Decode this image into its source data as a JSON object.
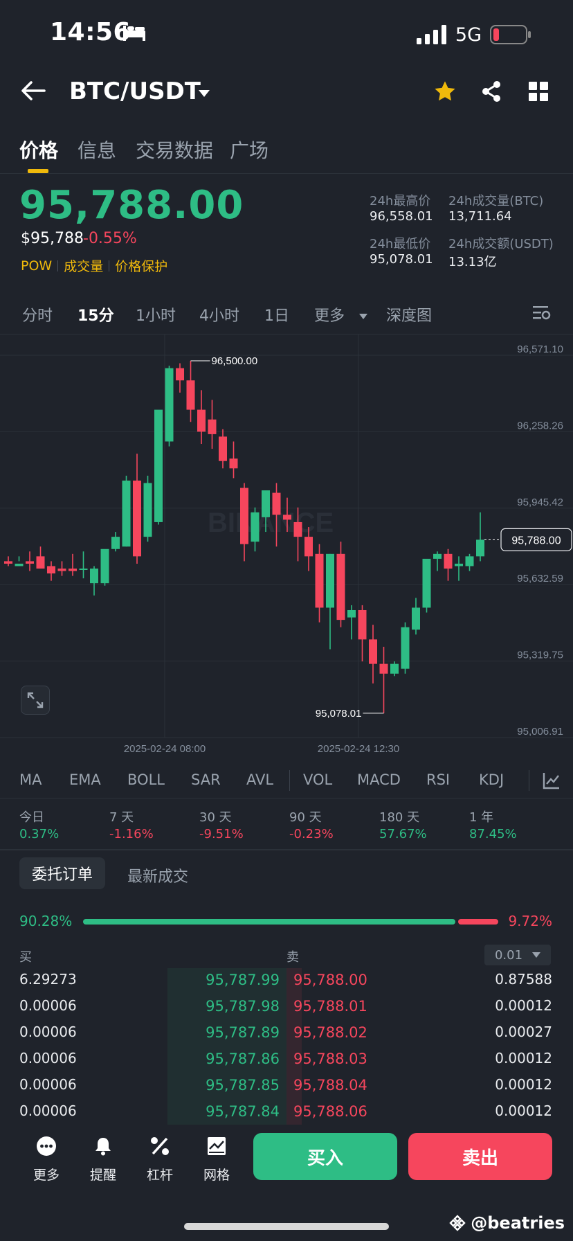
{
  "status_bar": {
    "time": "14:56",
    "network": "5G",
    "icons": [
      "bed-icon",
      "signal-icon",
      "battery-low-icon"
    ]
  },
  "header": {
    "pair": "BTC/USDT",
    "icons": [
      "back-arrow-icon",
      "caret-down-icon",
      "star-icon",
      "share-icon",
      "grid-icon"
    ]
  },
  "tabs": [
    {
      "label": "价格",
      "active": true
    },
    {
      "label": "信息"
    },
    {
      "label": "交易数据"
    },
    {
      "label": "广场"
    }
  ],
  "price": {
    "last": "95,788.00",
    "usd": "$95,788",
    "change_pct": "-0.55%",
    "tags": [
      "POW",
      "成交量",
      "价格保护"
    ]
  },
  "stats": {
    "high_label": "24h最高价",
    "high": "96,558.01",
    "vol_btc_label": "24h成交量(BTC)",
    "vol_btc": "13,711.64",
    "low_label": "24h最低价",
    "low": "95,078.01",
    "vol_usdt_label": "24h成交额(USDT)",
    "vol_usdt": "13.13亿"
  },
  "intervals": [
    {
      "label": "分时"
    },
    {
      "label": "15分",
      "active": true
    },
    {
      "label": "1小时"
    },
    {
      "label": "4小时"
    },
    {
      "label": "1日"
    },
    {
      "label": "更多"
    },
    {
      "label": "深度图"
    }
  ],
  "chart_data": {
    "type": "candlestick",
    "watermark": "BINANCE",
    "y_ticks": [
      "96,571.10",
      "96,258.26",
      "95,945.42",
      "95,632.59",
      "95,319.75",
      "95,006.91"
    ],
    "ylim": [
      95006.91,
      96571.1
    ],
    "x_ticks": [
      "2025-02-24 08:00",
      "2025-02-24 12:30"
    ],
    "current_price": "95,788.00",
    "high_label": "96,500.00",
    "low_label": "95,078.01",
    "candles": [
      [
        95700,
        95720,
        95690,
        95680
      ],
      [
        95680,
        95720,
        95690,
        95700
      ],
      [
        95700,
        95740,
        95690,
        95660
      ],
      [
        95720,
        95760,
        95670,
        95700
      ],
      [
        95680,
        95700,
        95650,
        95620
      ],
      [
        95670,
        95700,
        95660,
        95640
      ],
      [
        95670,
        95730,
        95660,
        95640
      ],
      [
        95670,
        95740,
        95670,
        95630
      ],
      [
        95610,
        95680,
        95670,
        95560
      ],
      [
        95610,
        95740,
        95750,
        95600
      ],
      [
        95750,
        95820,
        95800,
        95740
      ],
      [
        95760,
        96050,
        96030,
        95760
      ],
      [
        96030,
        96140,
        95720,
        95690
      ],
      [
        95800,
        96050,
        96020,
        95780
      ],
      [
        95860,
        96300,
        96320,
        95850
      ],
      [
        96190,
        96500,
        96490,
        96170
      ],
      [
        96490,
        96510,
        96440,
        96390
      ],
      [
        96440,
        96520,
        96320,
        96270
      ],
      [
        96320,
        96400,
        96230,
        96180
      ],
      [
        96280,
        96360,
        96220,
        96160
      ],
      [
        96210,
        96240,
        96110,
        96080
      ],
      [
        96120,
        96190,
        96080,
        96040
      ],
      [
        96000,
        96020,
        95770,
        95700
      ],
      [
        95780,
        95920,
        95900,
        95740
      ],
      [
        95880,
        95980,
        95990,
        95820
      ],
      [
        95980,
        96020,
        95890,
        95760
      ],
      [
        95890,
        95960,
        95870,
        95820
      ],
      [
        95860,
        95920,
        95800,
        95700
      ],
      [
        95800,
        95840,
        95720,
        95660
      ],
      [
        95730,
        95770,
        95510,
        95450
      ],
      [
        95510,
        95730,
        95730,
        95340
      ],
      [
        95730,
        95780,
        95460,
        95430
      ],
      [
        95470,
        95520,
        95500,
        95380
      ],
      [
        95500,
        95520,
        95380,
        95290
      ],
      [
        95380,
        95440,
        95280,
        95200
      ],
      [
        95280,
        95350,
        95240,
        95078
      ],
      [
        95240,
        95290,
        95280,
        95230
      ],
      [
        95260,
        95450,
        95430,
        95240
      ],
      [
        95420,
        95550,
        95510,
        95400
      ],
      [
        95510,
        95700,
        95710,
        95490
      ],
      [
        95710,
        95740,
        95730,
        95660
      ],
      [
        95730,
        95750,
        95670,
        95620
      ],
      [
        95680,
        95720,
        95690,
        95620
      ],
      [
        95680,
        95730,
        95720,
        95660
      ],
      [
        95720,
        95900,
        95788,
        95700
      ]
    ]
  },
  "indicators": [
    "MA",
    "EMA",
    "BOLL",
    "SAR",
    "AVL",
    "VOL",
    "MACD",
    "RSI",
    "KDJ"
  ],
  "performance": [
    {
      "label": "今日",
      "value": "0.37%",
      "color": "#2ebd85"
    },
    {
      "label": "7 天",
      "value": "-1.16%",
      "color": "#f6465d"
    },
    {
      "label": "30 天",
      "value": "-9.51%",
      "color": "#f6465d"
    },
    {
      "label": "90 天",
      "value": "-0.23%",
      "color": "#f6465d"
    },
    {
      "label": "180 天",
      "value": "57.67%",
      "color": "#2ebd85"
    },
    {
      "label": "1 年",
      "value": "87.45%",
      "color": "#2ebd85"
    }
  ],
  "orderbook": {
    "tab_orders": "委托订单",
    "tab_trades": "最新成交",
    "buy_ratio": "90.28%",
    "sell_ratio": "9.72%",
    "buy_label": "买",
    "sell_label": "卖",
    "precision": "0.01",
    "rows": [
      {
        "bid_qty": "6.29273",
        "bid": "95,787.99",
        "ask": "95,788.00",
        "ask_qty": "0.87588"
      },
      {
        "bid_qty": "0.00006",
        "bid": "95,787.98",
        "ask": "95,788.01",
        "ask_qty": "0.00012"
      },
      {
        "bid_qty": "0.00006",
        "bid": "95,787.89",
        "ask": "95,788.02",
        "ask_qty": "0.00027"
      },
      {
        "bid_qty": "0.00006",
        "bid": "95,787.86",
        "ask": "95,788.03",
        "ask_qty": "0.00012"
      },
      {
        "bid_qty": "0.00006",
        "bid": "95,787.85",
        "ask": "95,788.04",
        "ask_qty": "0.00012"
      },
      {
        "bid_qty": "0.00006",
        "bid": "95,787.84",
        "ask": "95,788.06",
        "ask_qty": "0.00012"
      }
    ]
  },
  "bottom_bar": {
    "items": [
      {
        "label": "更多"
      },
      {
        "label": "提醒"
      },
      {
        "label": "杠杆"
      },
      {
        "label": "网格"
      }
    ],
    "buy": "买入",
    "sell": "卖出"
  },
  "watermark": "@beatries",
  "colors": {
    "up": "#2ebd85",
    "down": "#f6465d",
    "accent": "#f0b90b",
    "bg": "#1f232b"
  }
}
